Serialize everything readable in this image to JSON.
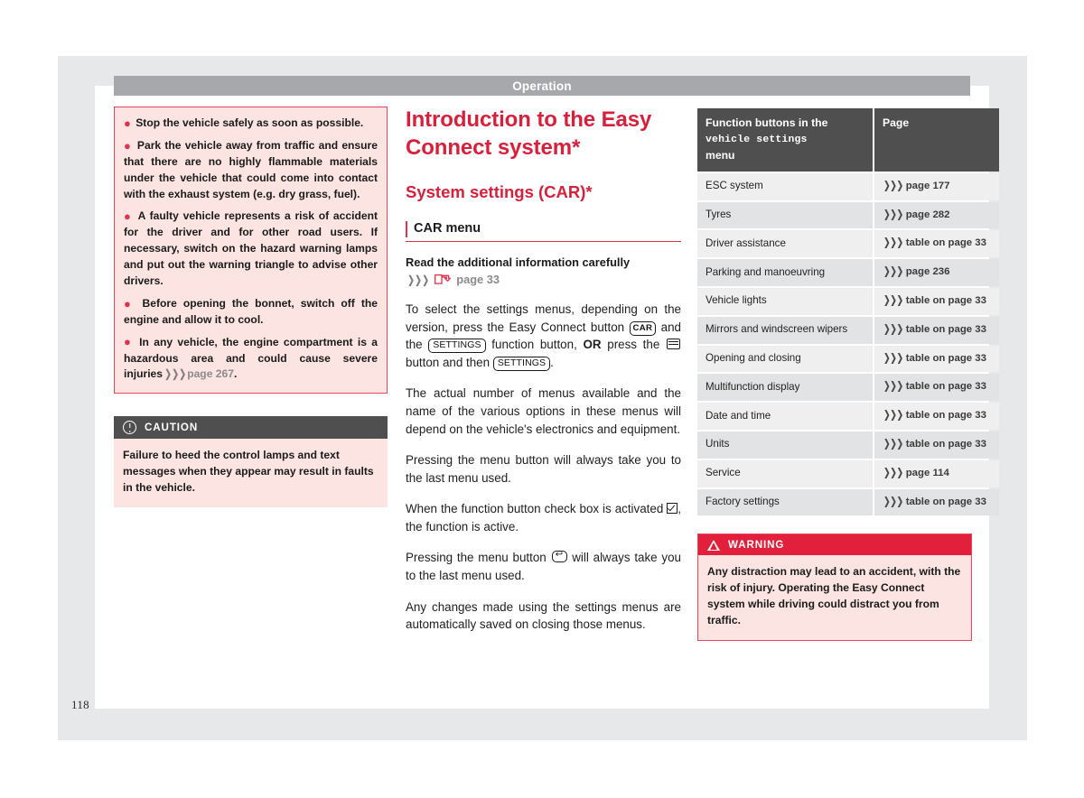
{
  "page": {
    "running_head": "Operation",
    "page_number": "118"
  },
  "colors": {
    "brand_red": "#d8203c",
    "notice_bg": "#fbe4e2",
    "notice_border": "#e5465c",
    "caution_head_bg": "#4f4f4f",
    "warning_head_bg": "#e2203c",
    "running_head_bg": "#a6a8ab",
    "table_head_bg": "#4f4f4f",
    "row_odd_bg": "#efeff0",
    "row_even_bg": "#e2e3e4"
  },
  "left_column": {
    "safety_notice": {
      "bullets": [
        "Stop the vehicle safely as soon as possible.",
        "Park the vehicle away from traffic and ensure that there are no highly flammable materials under the vehicle that could come into contact with the exhaust system (e.g. dry grass, fuel).",
        "A faulty vehicle represents a risk of accident for the driver and for other road users. If necessary, switch on the hazard warning lamps and put out the warning triangle to advise other drivers.",
        "Before opening the bonnet, switch off the engine and allow it to cool.",
        "In any vehicle, the engine compartment is a hazardous area and could cause severe injuries"
      ],
      "last_bullet_reference": "page 267",
      "last_bullet_suffix": "."
    },
    "caution": {
      "icon": "exclamation-circle-icon",
      "title": "CAUTION",
      "text": "Failure to heed the control lamps and text messages when they appear may result in faults in the vehicle."
    }
  },
  "middle_column": {
    "chapter_title": "Introduction to the Easy Connect system*",
    "section_title": "System settings (CAR)*",
    "subsection_title": "CAR menu",
    "lead": "Read the additional information carefully",
    "lead_reference": "page 33",
    "lead_icon": "manual-book-icon",
    "paragraphs": {
      "p1_part1": "To select the settings menus, depending on the version, press the Easy Connect button",
      "p1_key_car": "CAR",
      "p1_part2": "and the",
      "p1_key_settings_a": "SETTINGS",
      "p1_part3": "function button,",
      "p1_or": "OR",
      "p1_part4": "press the",
      "p1_icon_menu": "menu-button-icon",
      "p1_part5": "button and then",
      "p1_key_settings_b": "SETTINGS",
      "p1_part6": ".",
      "p2": "The actual number of menus available and the name of the various options in these menus will depend on the vehicle's electronics and equipment.",
      "p3": "Pressing the menu button will always take you to the last menu used.",
      "p4_part1": "When the function button check box is activated",
      "p4_icon": "checked-checkbox-icon",
      "p4_part2": ", the function is active.",
      "p5_part1": "Pressing the menu button",
      "p5_icon": "back-button-icon",
      "p5_part2": "will always take you to the last menu used.",
      "p6": "Any changes made using the settings menus are automatically saved on closing those menus."
    }
  },
  "right_column": {
    "table": {
      "headers": {
        "function_part1": "Function buttons in the",
        "function_part2": "vehicle settings",
        "function_part3": "menu",
        "page": "Page"
      },
      "rows": [
        {
          "name": "ESC system",
          "page": "page 177"
        },
        {
          "name": "Tyres",
          "page": "page 282"
        },
        {
          "name": "Driver assistance",
          "page": "table on page 33"
        },
        {
          "name": "Parking and manoeuvring",
          "page": "page 236"
        },
        {
          "name": "Vehicle lights",
          "page": "table on page 33"
        },
        {
          "name": "Mirrors and windscreen wipers",
          "page": "table on page 33"
        },
        {
          "name": "Opening and closing",
          "page": "table on page 33"
        },
        {
          "name": "Multifunction display",
          "page": "table on page 33"
        },
        {
          "name": "Date and time",
          "page": "table on page 33"
        },
        {
          "name": "Units",
          "page": "table on page 33"
        },
        {
          "name": "Service",
          "page": "page 114"
        },
        {
          "name": "Factory settings",
          "page": "table on page 33"
        }
      ]
    },
    "warning": {
      "icon": "warning-triangle-icon",
      "title": "WARNING",
      "text": "Any distraction may lead to an accident, with the risk of injury. Operating the Easy Connect system while driving could distract you from traffic."
    }
  }
}
